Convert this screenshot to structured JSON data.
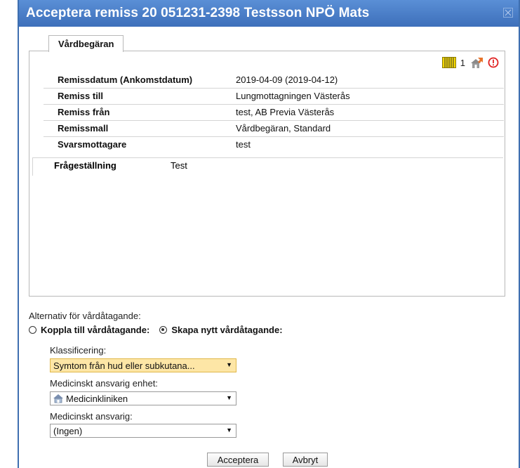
{
  "dialog": {
    "title": "Acceptera remiss 20 051231-2398 Testsson NPÖ Mats",
    "close_icon": "close-icon"
  },
  "tabs": [
    {
      "label": "Vårdbegäran"
    }
  ],
  "toolbar": {
    "count": "1",
    "icons": [
      "barcode-icon",
      "home-arrow-icon",
      "alert-icon"
    ],
    "colors": {
      "barcode": "#f5d800",
      "alert": "#e02020"
    }
  },
  "details": [
    {
      "label": "Remissdatum (Ankomstdatum)",
      "value": "2019-04-09 (2019-04-12)"
    },
    {
      "label": "Remiss till",
      "value": "Lungmottagningen Västerås"
    },
    {
      "label": "Remiss från",
      "value": "test, AB Previa Västerås"
    },
    {
      "label": "Remissmall",
      "value": "Vårdbegäran, Standard"
    },
    {
      "label": "Svarsmottagare",
      "value": "test"
    }
  ],
  "question": {
    "label": "Frågeställning",
    "value": "Test"
  },
  "alternatives": {
    "heading": "Alternativ för vårdåtagande:",
    "option_connect": "Koppla till vårdåtagande:",
    "option_new": "Skapa nytt vårdåtagande:",
    "selected": "option_new"
  },
  "form": {
    "classification_label": "Klassificering:",
    "classification_value": "Symtom från hud eller subkutana...",
    "unit_label": "Medicinskt ansvarig enhet:",
    "unit_value": "Medicinkliniken",
    "unit_icon": "home-icon",
    "responsible_label": "Medicinskt ansvarig:",
    "responsible_value": "(Ingen)"
  },
  "buttons": {
    "accept": "Acceptera",
    "cancel": "Avbryt"
  },
  "colors": {
    "titlebar": "#3d6fba",
    "highlight_field": "#fde6a6"
  }
}
